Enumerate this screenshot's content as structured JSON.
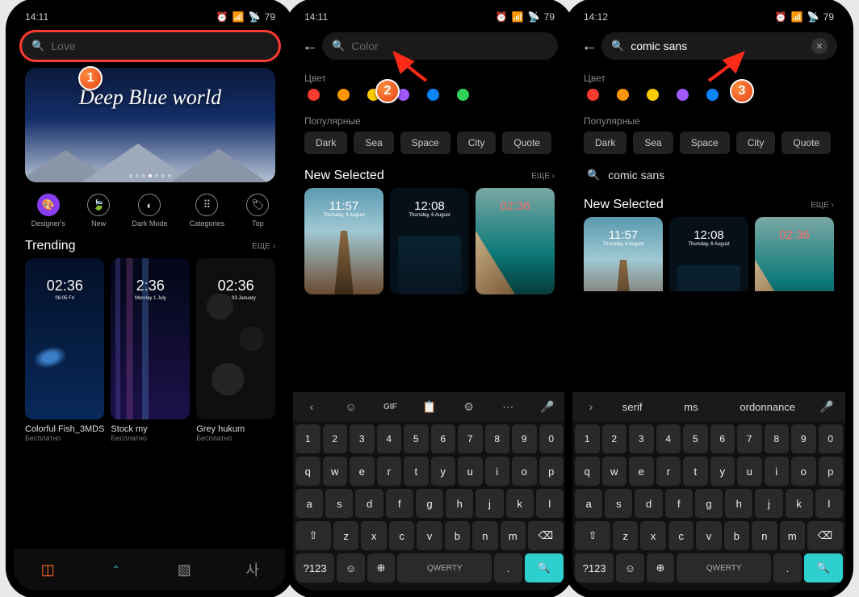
{
  "statusbar": {
    "time1": "14:11",
    "time2": "14:11",
    "time3": "14:12",
    "battery": "79"
  },
  "screen1": {
    "searchPlaceholder": "Love",
    "heroTitle": "Deep Blue world",
    "categories": [
      {
        "label": "Designer's",
        "icon": "🎨"
      },
      {
        "label": "New",
        "icon": "🍃"
      },
      {
        "label": "Dark Mode",
        "icon": "◐"
      },
      {
        "label": "Categories",
        "icon": "⠿"
      },
      {
        "label": "Top",
        "icon": "🏷"
      }
    ],
    "trendingLabel": "Trending",
    "moreLabel": "ЕЩЕ",
    "themes": [
      {
        "name": "Colorful Fish_3MDS",
        "price": "Бесплатно",
        "clock": "02:36",
        "date": "06:05 Fri"
      },
      {
        "name": "Stock my",
        "price": "Бесплатно",
        "clock": "2:36",
        "date": "Monday 1 July"
      },
      {
        "name": "Grey hukum",
        "price": "Бесплатно",
        "clock": "02:36",
        "date": "Friday, 03 January"
      }
    ]
  },
  "screen2": {
    "searchPlaceholder": "Color",
    "colorLabel": "Цвет",
    "colors": [
      "#ff3b30",
      "#ff9500",
      "#ffcc00",
      "#a259ff",
      "#0a84ff",
      "#30d158"
    ],
    "popularLabel": "Популярные",
    "tags": [
      "Dark",
      "Sea",
      "Space",
      "City",
      "Quote"
    ],
    "newSelected": "New Selected",
    "moreLabel": "ЕЩЕ",
    "themes": [
      {
        "clock": "11:57",
        "date": "Thursday, 6 August"
      },
      {
        "clock": "12:08",
        "date": "Thursday, 6 August"
      },
      {
        "clock": "02:36",
        "date": ""
      }
    ],
    "kbStrip": [
      "‹",
      "☺",
      "GIF",
      "📋",
      "⚙",
      "⋯",
      "🎤"
    ]
  },
  "screen3": {
    "searchValue": "comic sans",
    "colorLabel": "Цвет",
    "colors": [
      "#ff3b30",
      "#ff9500",
      "#ffcc00",
      "#a259ff",
      "#0a84ff",
      "#30d158"
    ],
    "popularLabel": "Популярные",
    "tags": [
      "Dark",
      "Sea",
      "Space",
      "City",
      "Quote"
    ],
    "suggestion": "comic sans",
    "newSelected": "New Selected",
    "moreLabel": "ЕЩЕ",
    "themes": [
      {
        "clock": "11:57",
        "date": "Thursday, 6 August"
      },
      {
        "clock": "12:08",
        "date": "Thursday, 6 August"
      },
      {
        "clock": "02:36",
        "date": ""
      }
    ],
    "suggestions": [
      "serif",
      "ms",
      "ordonnance"
    ]
  },
  "keyboard": {
    "nums": [
      "1",
      "2",
      "3",
      "4",
      "5",
      "6",
      "7",
      "8",
      "9",
      "0"
    ],
    "row1": [
      "q",
      "w",
      "e",
      "r",
      "t",
      "y",
      "u",
      "i",
      "o",
      "p"
    ],
    "row2": [
      "a",
      "s",
      "d",
      "f",
      "g",
      "h",
      "j",
      "k",
      "l"
    ],
    "row3": [
      "z",
      "x",
      "c",
      "v",
      "b",
      "n",
      "m"
    ],
    "shift": "⇧",
    "bksp": "⌫",
    "sym": "?123",
    "emoji": "☺",
    "globe": "⊕",
    "space": "QWERTY",
    "enter": "🔍",
    "mic": "🎤",
    "chev": "›"
  },
  "callouts": {
    "b1": "1",
    "b2": "2",
    "b3": "3"
  }
}
